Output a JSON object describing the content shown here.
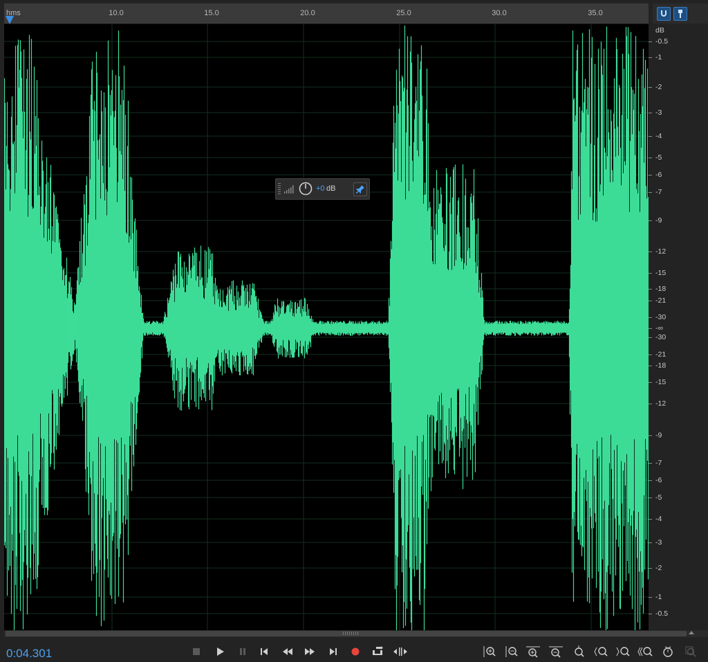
{
  "ruler": {
    "unit": "hms",
    "ticks": [
      {
        "label": "10.0"
      },
      {
        "label": "15.0"
      },
      {
        "label": "20.0"
      },
      {
        "label": "25.0"
      },
      {
        "label": "30.0"
      },
      {
        "label": "35.0"
      }
    ]
  },
  "db_scale": {
    "unit": "dB",
    "labels": [
      "-0.5",
      "-1",
      "-2",
      "-3",
      "-4",
      "-5",
      "-6",
      "-7",
      "-9",
      "-12",
      "-15",
      "-18",
      "-21",
      "-30",
      "-∞",
      "-30",
      "-21",
      "-18",
      "-15",
      "-12",
      "-9",
      "-7",
      "-6",
      "-5",
      "-4",
      "-3",
      "-2",
      "-1",
      "-0.5"
    ]
  },
  "hud": {
    "gain_value": "+0",
    "gain_unit": "dB"
  },
  "transport": {
    "timecode": "0:04.301"
  },
  "colors": {
    "waveform": "#3ddc97",
    "background": "#000000",
    "timecode": "#4ea0ee",
    "record": "#e8453c"
  }
}
